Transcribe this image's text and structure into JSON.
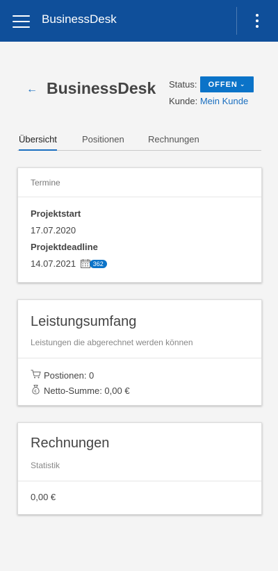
{
  "app": {
    "title": "BusinessDesk"
  },
  "page": {
    "title": "BusinessDesk",
    "status_label": "Status:",
    "status_value": "OFFEN",
    "customer_label": "Kunde:",
    "customer_value": "Mein Kunde"
  },
  "tabs": [
    {
      "label": "Übersicht",
      "active": true
    },
    {
      "label": "Positionen",
      "active": false
    },
    {
      "label": "Rechnungen",
      "active": false
    }
  ],
  "termine": {
    "title": "Termine",
    "start_label": "Projektstart",
    "start_value": "17.07.2020",
    "deadline_label": "Projektdeadline",
    "deadline_value": "14.07.2021",
    "days_badge": "362"
  },
  "leistung": {
    "title": "Leistungsumfang",
    "subtitle": "Leistungen die abgerechnet werden können",
    "positions_text": "Postionen: 0",
    "netto_text": "Netto-Summe: 0,00 €"
  },
  "rechnungen": {
    "title": "Rechnungen",
    "subtitle": "Statistik",
    "amount": "0,00 €"
  },
  "colors": {
    "topbar": "#0f4f9a",
    "accent": "#0b73c8",
    "link": "#1a6fc0"
  },
  "icons": [
    "hamburger-menu-icon",
    "more-vertical-icon",
    "back-arrow-icon",
    "chevron-down-icon",
    "calendar-icon",
    "shopping-cart-icon",
    "money-bag-icon"
  ]
}
